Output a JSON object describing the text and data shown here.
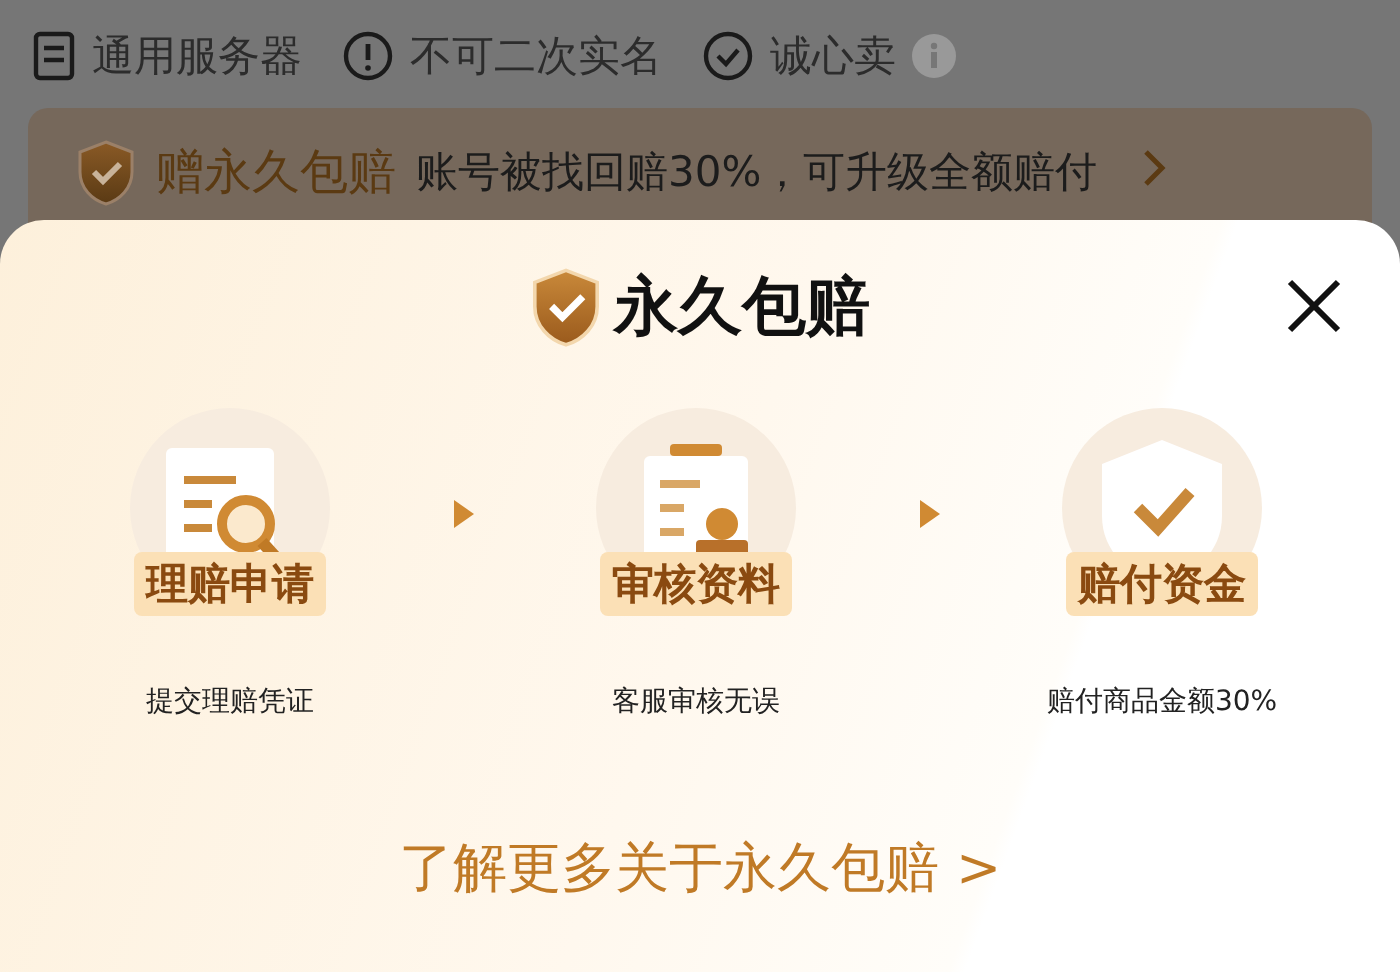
{
  "features": [
    {
      "kind": "server",
      "label": "通用服务器",
      "info": false
    },
    {
      "kind": "alert",
      "label": "不可二次实名",
      "info": false
    },
    {
      "kind": "check",
      "label": "诚心卖",
      "info": true
    }
  ],
  "banner": {
    "title": "赠永久包赔",
    "text": "账号被找回赔30%，可升级全额赔付"
  },
  "sheet": {
    "title": "永久包赔",
    "steps": [
      {
        "kind": "apply",
        "label": "理赔申请",
        "caption": "提交理赔凭证"
      },
      {
        "kind": "review",
        "label": "审核资料",
        "caption": "客服审核无误"
      },
      {
        "kind": "pay",
        "label": "赔付资金",
        "caption": "赔付商品金额30%"
      }
    ],
    "link": "了解更多关于永久包赔 >"
  }
}
